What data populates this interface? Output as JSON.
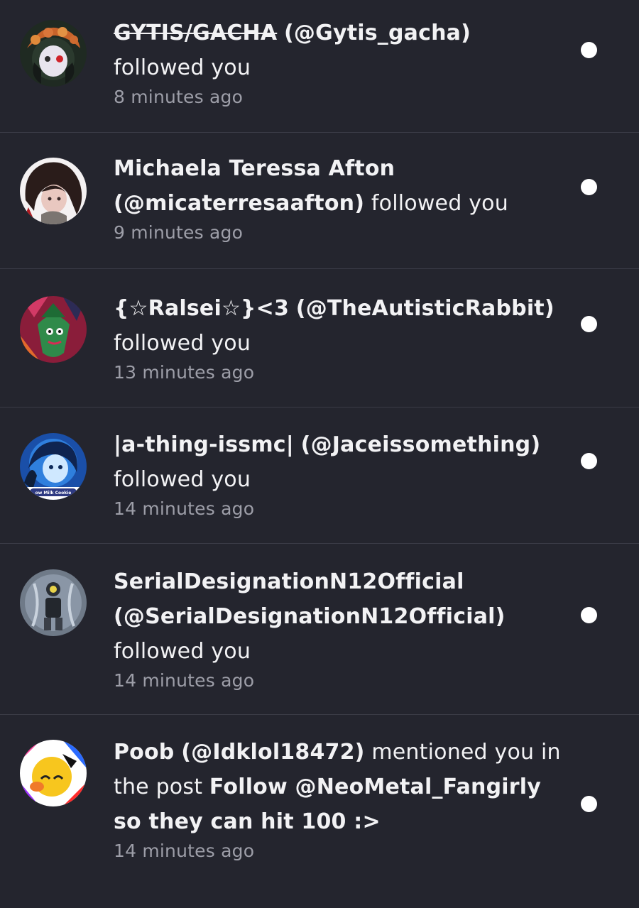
{
  "notifications": [
    {
      "name": "GYTIS/GACHA",
      "handle": "(@Gytis_gacha)",
      "action": "followed you",
      "time": "8 minutes ago",
      "avatar": "avatar-image",
      "unread": true
    },
    {
      "name": "Michaela Teressa Afton",
      "handle": "(@micaterresaafton)",
      "action": "followed you",
      "time": "9 minutes ago",
      "avatar": "avatar-image",
      "unread": true
    },
    {
      "name": "{☆Ralsei☆}<3",
      "handle": "(@TheAutisticRabbit)",
      "action": "followed you",
      "time": "13 minutes ago",
      "avatar": "avatar-image",
      "unread": true
    },
    {
      "name": "|a-thing-issmc|",
      "handle": "(@Jaceissomething)",
      "action": "followed you",
      "time": "14 minutes ago",
      "avatar": "avatar-image",
      "avatar_caption": "ow Milk Cookie",
      "unread": true
    },
    {
      "name": "SerialDesignationN12Official",
      "handle": "(@SerialDesignationN12Official)",
      "action": "followed you",
      "time": "14 minutes ago",
      "avatar": "avatar-image",
      "unread": true
    },
    {
      "name": "Poob",
      "handle": "(@Idklol18472)",
      "action": "mentioned you in the post",
      "post_title": "Follow @NeoMetal_Fangirly so they can hit 100 :>",
      "time": "14 minutes ago",
      "avatar": "avatar-image",
      "unread": true
    }
  ],
  "colors": {
    "background": "#24252e",
    "divider": "#3b3c47",
    "text": "#f2f2f4",
    "muted": "#9d9ea8",
    "unread_dot": "#ffffff"
  }
}
